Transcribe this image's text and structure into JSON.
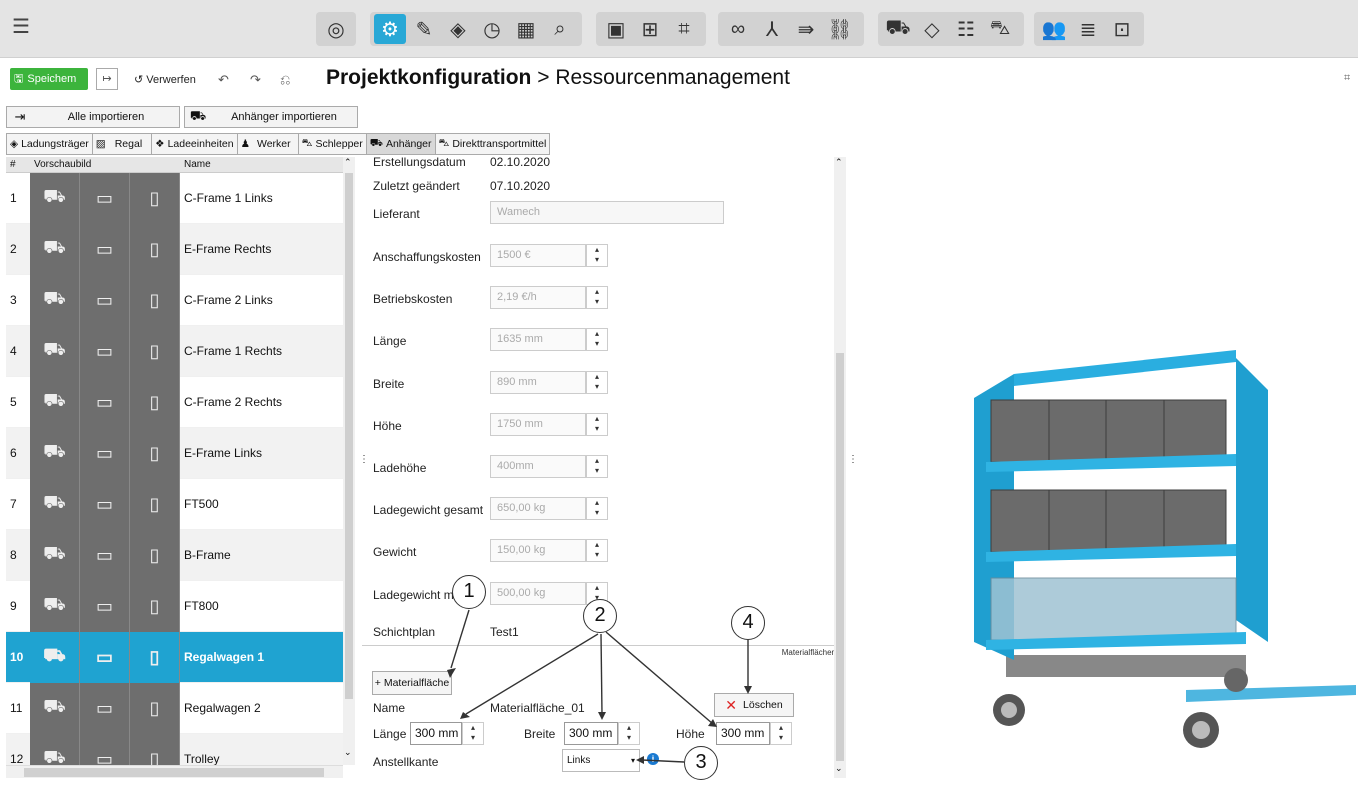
{
  "toolbar": {
    "groups": [
      {
        "icons": [
          "target-icon"
        ]
      },
      {
        "icons": [
          "resource-icon",
          "ruler-icon",
          "shapes-icon",
          "clock-icon",
          "calc-icon",
          "search-icon"
        ]
      },
      {
        "icons": [
          "layout-icon",
          "grid-icon",
          "frame-icon"
        ]
      },
      {
        "icons": [
          "link-icon",
          "branch-icon",
          "flow-icon",
          "chain-icon"
        ]
      },
      {
        "icons": [
          "cart-icon",
          "load-icon",
          "shelf-icon",
          "forklift-icon"
        ]
      },
      {
        "icons": [
          "people-icon",
          "stats-icon",
          "settings-frame-icon"
        ]
      }
    ]
  },
  "actions": {
    "save": "Speichem",
    "discard": "Verwerfen"
  },
  "title": {
    "main": "Projektkonfiguration",
    "sep": ">",
    "sub": "Ressourcenmanagement"
  },
  "import": {
    "all": "Alle importieren",
    "trailer": "Anhänger importieren"
  },
  "tabs": [
    "Ladungsträger",
    "Regal",
    "Ladeeinheiten",
    "Werker",
    "Schlepper",
    "Anhänger",
    "Direkttransportmittel"
  ],
  "list": {
    "headers": {
      "num": "#",
      "preview": "Vorschaubild",
      "name": "Name"
    },
    "rows": [
      {
        "num": "1",
        "name": "C-Frame 1 Links"
      },
      {
        "num": "2",
        "name": "E-Frame Rechts"
      },
      {
        "num": "3",
        "name": "C-Frame 2 Links"
      },
      {
        "num": "4",
        "name": "C-Frame 1 Rechts"
      },
      {
        "num": "5",
        "name": "C-Frame 2 Rechts"
      },
      {
        "num": "6",
        "name": "E-Frame Links"
      },
      {
        "num": "7",
        "name": "FT500"
      },
      {
        "num": "8",
        "name": "B-Frame"
      },
      {
        "num": "9",
        "name": "FT800"
      },
      {
        "num": "10",
        "name": "Regalwagen 1"
      },
      {
        "num": "11",
        "name": "Regalwagen 2"
      },
      {
        "num": "12",
        "name": "Trolley"
      }
    ]
  },
  "form": {
    "created_label": "Erstellungsdatum",
    "created_value": "02.10.2020",
    "changed_label": "Zuletzt geändert",
    "changed_value": "07.10.2020",
    "supplier_label": "Lieferant",
    "supplier_value": "Wamech",
    "fields": [
      {
        "label": "Anschaffungskosten",
        "value": "1500 €"
      },
      {
        "label": "Betriebskosten",
        "value": "2,19 €/h"
      },
      {
        "label": "Länge",
        "value": "1635 mm"
      },
      {
        "label": "Breite",
        "value": "890 mm"
      },
      {
        "label": "Höhe",
        "value": "1750 mm"
      },
      {
        "label": "Ladehöhe",
        "value": "400mm"
      },
      {
        "label": "Ladegewicht gesamt",
        "value": "650,00 kg"
      },
      {
        "label": "Gewicht",
        "value": "150,00 kg"
      },
      {
        "label": "Ladegewicht m",
        "value": "500,00 kg"
      }
    ],
    "shift_label": "Schichtplan",
    "shift_value": "Test1",
    "material_section": "Materialflächen",
    "add_material": "+ Materialfläche",
    "name_label": "Name",
    "name_value": "Materialfläche_01",
    "delete": "Löschen",
    "length_label": "Länge",
    "length_value": "300 mm",
    "width_label": "Breite",
    "width_value": "300 mm",
    "height_label": "Höhe",
    "height_value": "300 mm",
    "edge_label": "Anstellkante",
    "edge_value": "Links"
  },
  "callouts": [
    "1",
    "2",
    "3",
    "4"
  ]
}
